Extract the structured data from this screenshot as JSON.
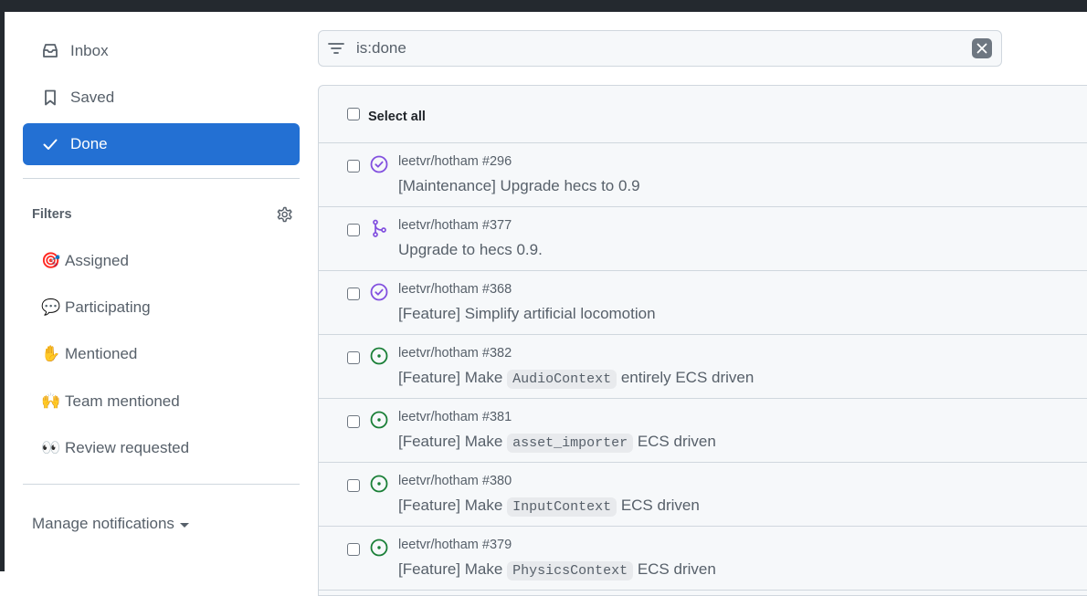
{
  "sidebar": {
    "nav": [
      {
        "label": "Inbox",
        "icon": "inbox-icon",
        "active": false
      },
      {
        "label": "Saved",
        "icon": "bookmark-icon",
        "active": false
      },
      {
        "label": "Done",
        "icon": "check-icon",
        "active": true
      }
    ],
    "filters_title": "Filters",
    "filters": [
      {
        "emoji": "🎯",
        "label": "Assigned"
      },
      {
        "emoji": "💬",
        "label": "Participating"
      },
      {
        "emoji": "✋",
        "label": "Mentioned"
      },
      {
        "emoji": "🙌",
        "label": "Team mentioned"
      },
      {
        "emoji": "👀",
        "label": "Review requested"
      }
    ],
    "manage_label": "Manage notifications"
  },
  "search": {
    "value": "is:done"
  },
  "list": {
    "select_all_label": "Select all",
    "items": [
      {
        "repo": "leetvr/hotham #296",
        "state": "issue-closed",
        "title_pre": "[Maintenance] Upgrade hecs to 0.9",
        "code": "",
        "title_post": ""
      },
      {
        "repo": "leetvr/hotham #377",
        "state": "pr-merged",
        "title_pre": "Upgrade to hecs 0.9.",
        "code": "",
        "title_post": ""
      },
      {
        "repo": "leetvr/hotham #368",
        "state": "issue-closed",
        "title_pre": "[Feature] Simplify artificial locomotion",
        "code": "",
        "title_post": ""
      },
      {
        "repo": "leetvr/hotham #382",
        "state": "issue-open",
        "title_pre": "[Feature] Make ",
        "code": "AudioContext",
        "title_post": " entirely ECS driven"
      },
      {
        "repo": "leetvr/hotham #381",
        "state": "issue-open",
        "title_pre": "[Feature] Make ",
        "code": "asset_importer",
        "title_post": " ECS driven"
      },
      {
        "repo": "leetvr/hotham #380",
        "state": "issue-open",
        "title_pre": "[Feature] Make ",
        "code": "InputContext",
        "title_post": " ECS driven"
      },
      {
        "repo": "leetvr/hotham #379",
        "state": "issue-open",
        "title_pre": "[Feature] Make ",
        "code": "PhysicsContext",
        "title_post": " ECS driven"
      }
    ]
  },
  "colors": {
    "accent": "#2370d3",
    "closed_purple": "#8250df",
    "open_green": "#1a7f37"
  }
}
